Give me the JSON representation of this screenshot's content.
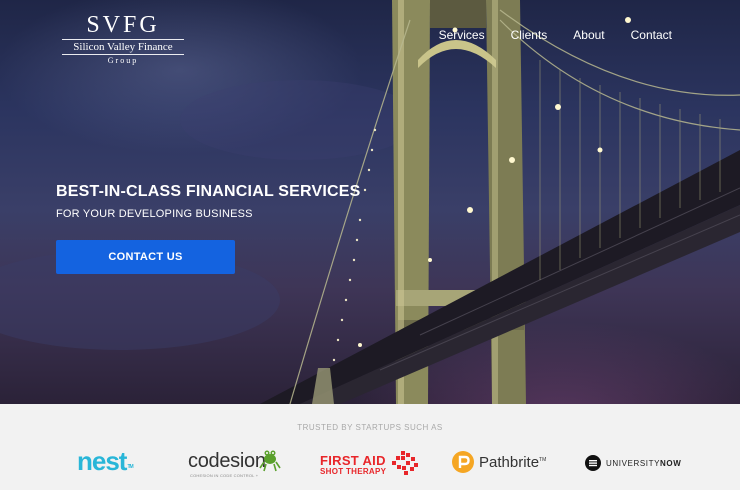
{
  "logo": {
    "mark": "SVFG",
    "name": "Silicon Valley Finance",
    "sub": "Group"
  },
  "nav": {
    "items": [
      {
        "label": "Services"
      },
      {
        "label": "Clients"
      },
      {
        "label": "About"
      },
      {
        "label": "Contact"
      }
    ]
  },
  "hero": {
    "headline": "BEST-IN-CLASS FINANCIAL SERVICES",
    "subhead": "FOR YOUR DEVELOPING BUSINESS",
    "cta_label": "CONTACT US"
  },
  "trust": {
    "title": "TRUSTED BY STARTUPS SUCH AS",
    "logos": {
      "nest": {
        "name": "nest",
        "mark": "TM"
      },
      "codesion": {
        "name": "codesion",
        "tagline": "COHESION IN CODE CONTROL +"
      },
      "firstaid": {
        "line1": "FIRST AID",
        "line2": "SHOT THERAPY"
      },
      "pathbrite": {
        "name": "Pathbrite",
        "mark": "TM"
      },
      "universitynow": {
        "name_light": "UNIVERSITY",
        "name_bold": "NOW"
      }
    }
  },
  "colors": {
    "cta_blue": "#1463e0",
    "nest_blue": "#29b6d8",
    "firstaid_red": "#e8262a",
    "pathbrite_orange": "#f5a623"
  }
}
